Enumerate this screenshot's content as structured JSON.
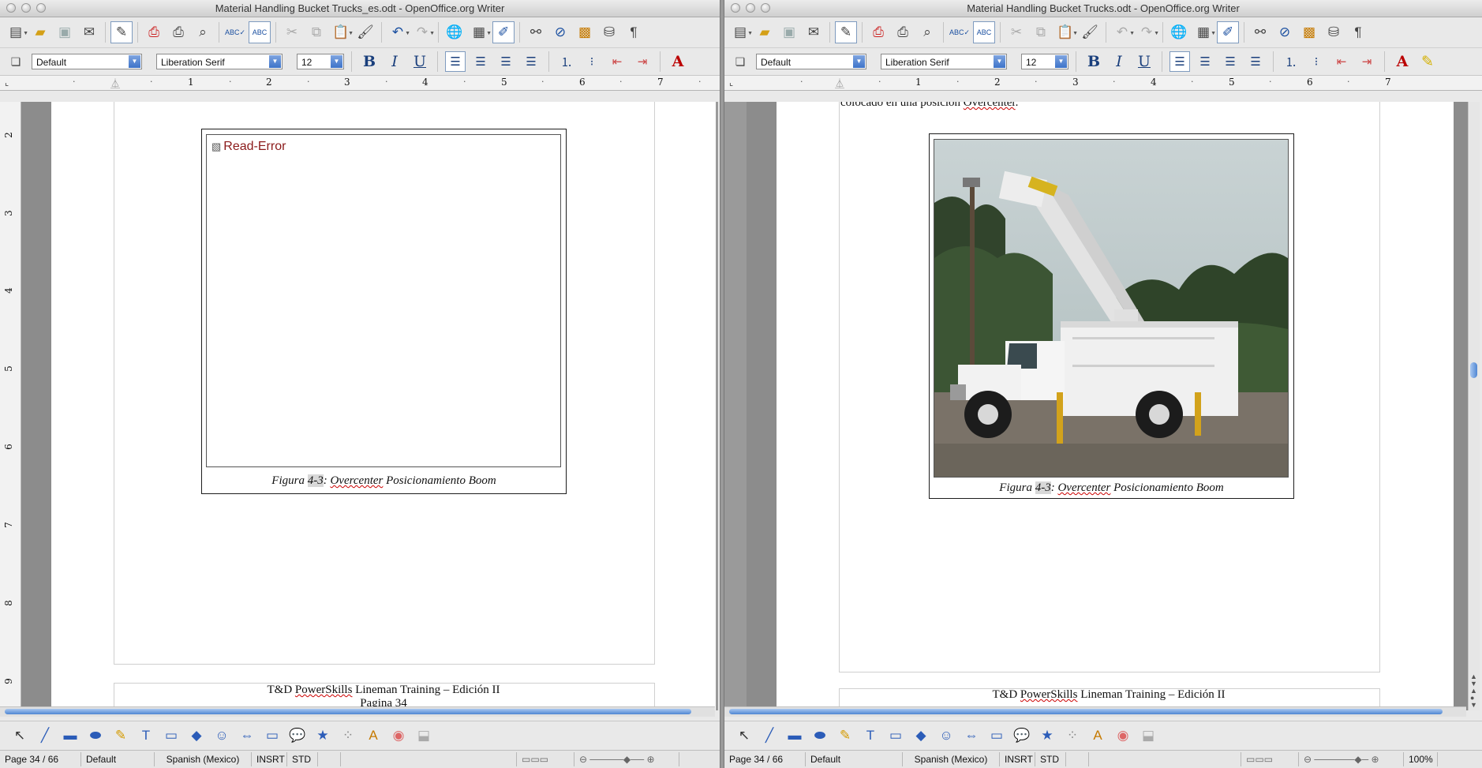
{
  "left_window": {
    "title": "Material Handling Bucket Trucks_es.odt - OpenOffice.org Writer",
    "paragraph_style": "Default",
    "font_name": "Liberation Serif",
    "font_size": "12",
    "ruler_numbers": [
      "1",
      "2",
      "3",
      "4",
      "5",
      "6",
      "7"
    ],
    "vruler_numbers": [
      "2",
      "3",
      "4",
      "5",
      "6",
      "7",
      "8",
      "9"
    ],
    "read_error": "Read-Error",
    "caption": {
      "prefix": "Figura ",
      "num": "4-3",
      "rest": ": ",
      "word": "Overcenter",
      "tail": " Posicionamiento Boom"
    },
    "footer_line1_a": "T&D ",
    "footer_line1_b": "PowerSkills",
    "footer_line1_c": " Lineman Training – Edición II",
    "footer_line2": "Pagina 34",
    "status": {
      "page": "Page 34 / 66",
      "style": "Default",
      "lang": "Spanish (Mexico)",
      "insert": "INSRT",
      "sel": "STD"
    }
  },
  "right_window": {
    "title": "Material Handling Bucket Trucks.odt - OpenOffice.org Writer",
    "paragraph_style": "Default",
    "font_name": "Liberation Serif",
    "font_size": "12",
    "ruler_numbers": [
      "1",
      "2",
      "3",
      "4",
      "5",
      "6",
      "7"
    ],
    "top_text_a": "colocado en una posición ",
    "top_text_b": "Overcenter",
    "top_text_c": ".",
    "caption": {
      "prefix": "Figura ",
      "num": "4-3",
      "rest": ": ",
      "word": "Overcenter",
      "tail": " Posicionamiento Boom"
    },
    "footer_line1_a": "T&D ",
    "footer_line1_b": "PowerSkills",
    "footer_line1_c": " Lineman Training – Edición II",
    "status": {
      "page": "Page 34 / 66",
      "style": "Default",
      "lang": "Spanish (Mexico)",
      "insert": "INSRT",
      "sel": "STD",
      "zoom": "100%"
    }
  }
}
